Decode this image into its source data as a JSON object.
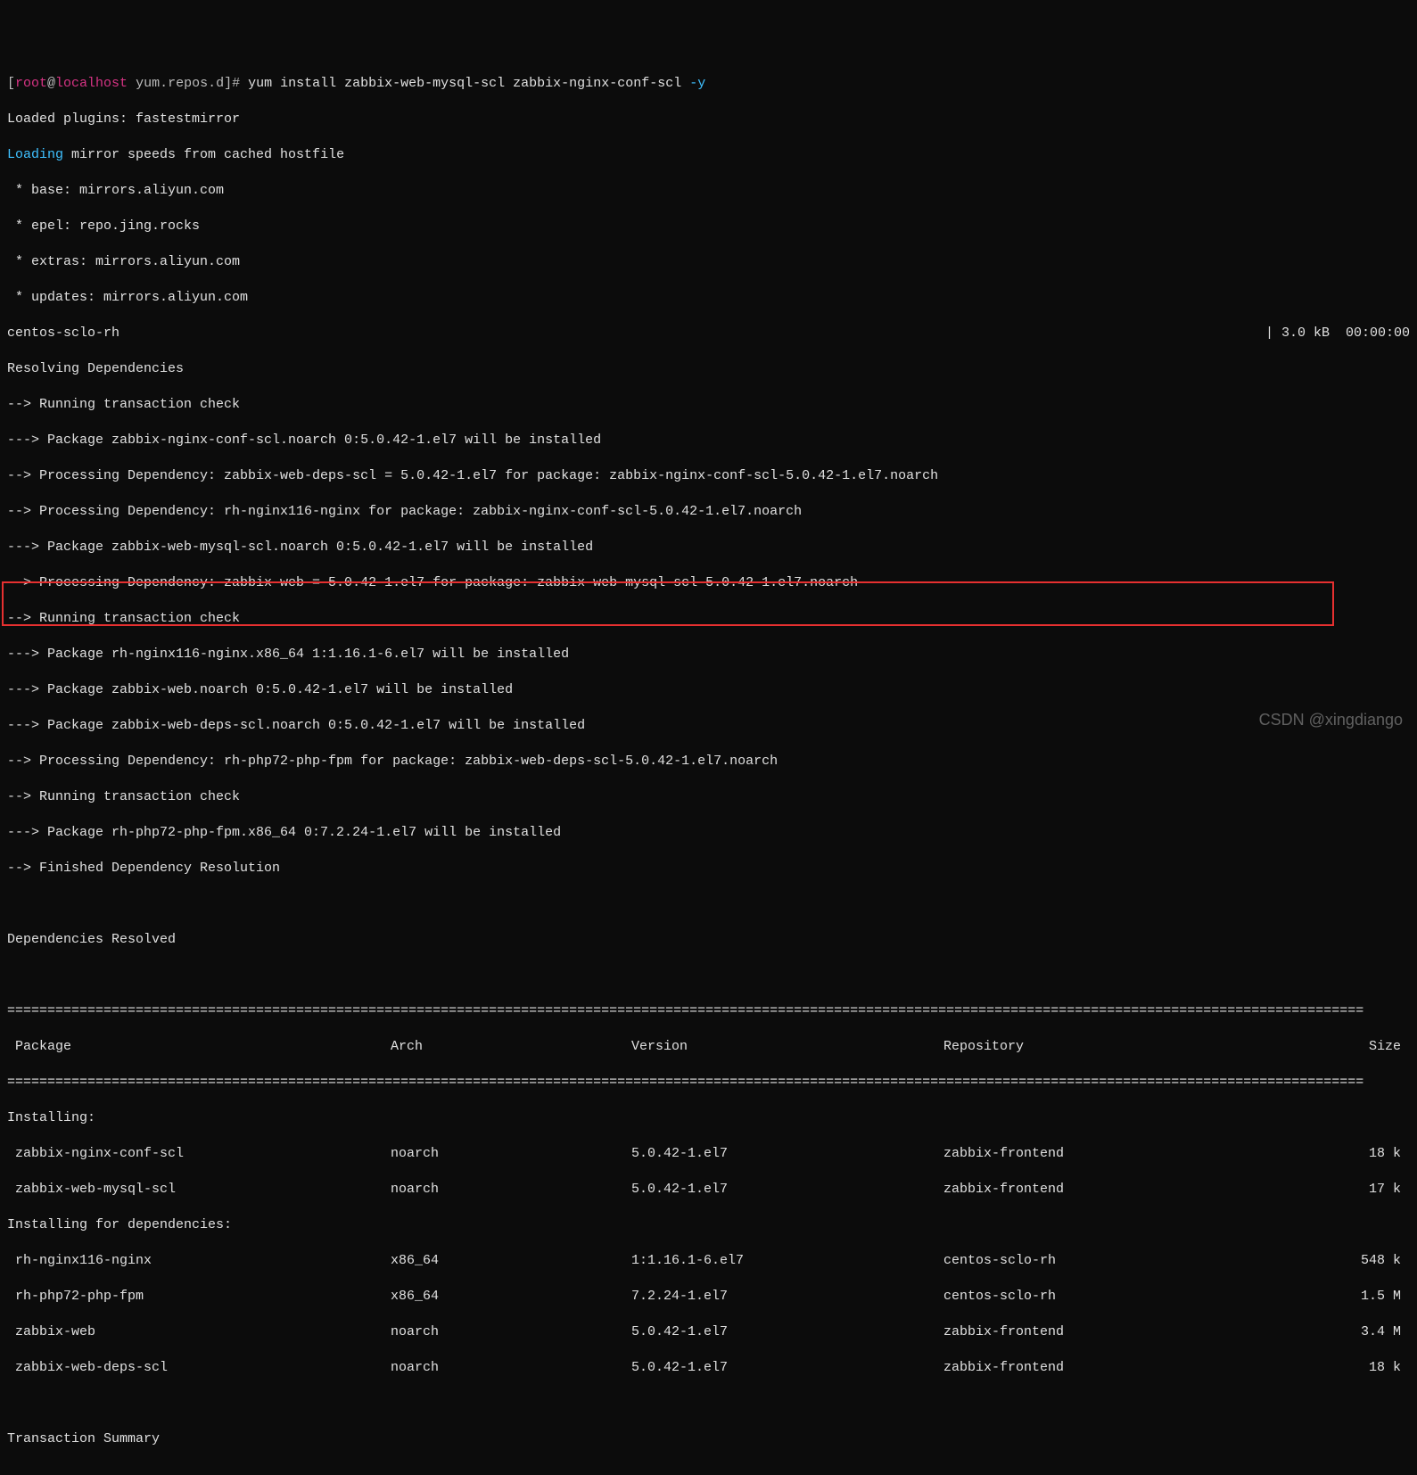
{
  "prompt": {
    "user": "root",
    "host": "localhost",
    "cwd": "yum.repos.d",
    "command": "yum install zabbix-web-mysql-scl zabbix-nginx-conf-scl",
    "flag": "-y"
  },
  "lines": {
    "l1": "Loaded plugins: fastestmirror",
    "l2a": "Loading",
    "l2b": " mirror speeds from cached hostfile",
    "l3": " * base: mirrors.aliyun.com",
    "l4": " * epel: repo.jing.rocks",
    "l5": " * extras: mirrors.aliyun.com",
    "l6": " * updates: mirrors.aliyun.com",
    "l7a": "centos-sclo-rh",
    "l7b": "| 3.0 kB  00:00:00",
    "l8": "Resolving Dependencies",
    "l9": "--> Running transaction check",
    "l10": "---> Package zabbix-nginx-conf-scl.noarch 0:5.0.42-1.el7 will be installed",
    "l11": "--> Processing Dependency: zabbix-web-deps-scl = 5.0.42-1.el7 for package: zabbix-nginx-conf-scl-5.0.42-1.el7.noarch",
    "l12": "--> Processing Dependency: rh-nginx116-nginx for package: zabbix-nginx-conf-scl-5.0.42-1.el7.noarch",
    "l13": "---> Package zabbix-web-mysql-scl.noarch 0:5.0.42-1.el7 will be installed",
    "l14": "--> Processing Dependency: zabbix-web = 5.0.42-1.el7 for package: zabbix-web-mysql-scl-5.0.42-1.el7.noarch",
    "l15": "--> Running transaction check",
    "l16": "---> Package rh-nginx116-nginx.x86_64 1:1.16.1-6.el7 will be installed",
    "l17": "---> Package zabbix-web.noarch 0:5.0.42-1.el7 will be installed",
    "l18": "---> Package zabbix-web-deps-scl.noarch 0:5.0.42-1.el7 will be installed",
    "l19": "--> Processing Dependency: rh-php72-php-fpm for package: zabbix-web-deps-scl-5.0.42-1.el7.noarch",
    "l20": "--> Running transaction check",
    "l21": "---> Package rh-php72-php-fpm.x86_64 0:7.2.24-1.el7 will be installed",
    "l22": "--> Finished Dependency Resolution",
    "l23": "Dependencies Resolved"
  },
  "headers": {
    "c1": " Package",
    "c2": "Arch",
    "c3": "Version",
    "c4": "Repository",
    "c5": "Size"
  },
  "sections": {
    "installing": "Installing:",
    "installing_deps": "Installing for dependencies:",
    "tx_summary": "Transaction Summary"
  },
  "rows": [
    {
      "pkg": " zabbix-nginx-conf-scl",
      "arch": "noarch",
      "ver": "5.0.42-1.el7",
      "repo": "zabbix-frontend",
      "size": "18 k"
    },
    {
      "pkg": " zabbix-web-mysql-scl",
      "arch": "noarch",
      "ver": "5.0.42-1.el7",
      "repo": "zabbix-frontend",
      "size": "17 k"
    },
    {
      "pkg": " rh-nginx116-nginx",
      "arch": "x86_64",
      "ver": "1:1.16.1-6.el7",
      "repo": "centos-sclo-rh",
      "size": "548 k"
    },
    {
      "pkg": " rh-php72-php-fpm",
      "arch": "x86_64",
      "ver": "7.2.24-1.el7",
      "repo": "centos-sclo-rh",
      "size": "1.5 M"
    },
    {
      "pkg": " zabbix-web",
      "arch": "noarch",
      "ver": "5.0.42-1.el7",
      "repo": "zabbix-frontend",
      "size": "3.4 M"
    },
    {
      "pkg": " zabbix-web-deps-scl",
      "arch": "noarch",
      "ver": "5.0.42-1.el7",
      "repo": "zabbix-frontend",
      "size": "18 k"
    }
  ],
  "separator": "=========================================================================================================================================================================",
  "watermark": "CSDN @xingdiango"
}
